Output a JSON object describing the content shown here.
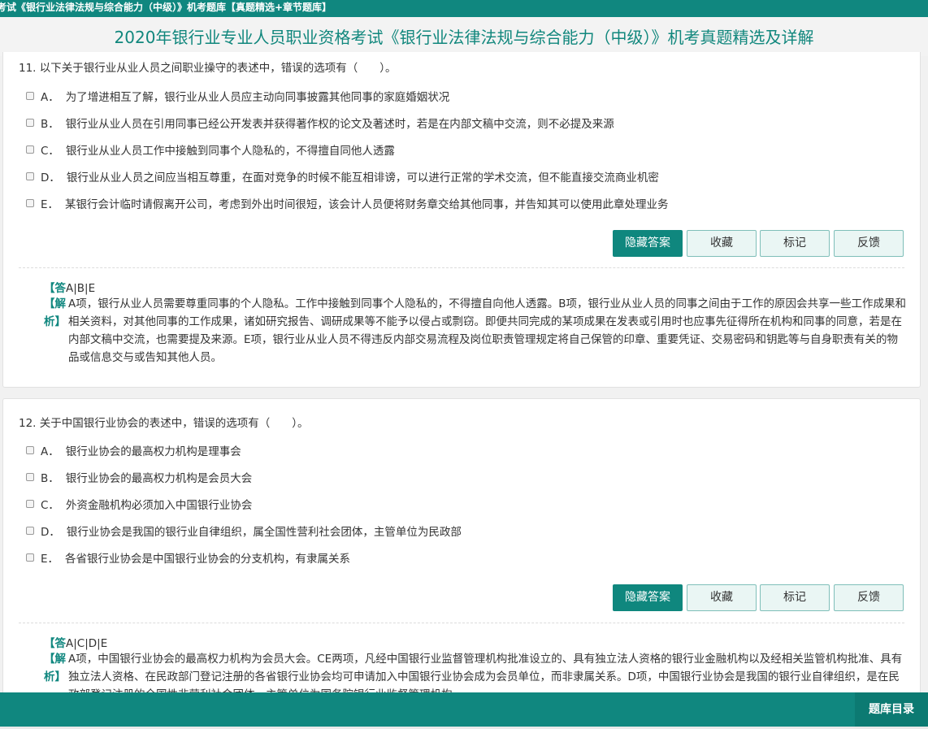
{
  "header": {
    "breadcrumb": "考试《银行业法律法规与综合能力（中级）》机考题库【真题精选+章节题库】",
    "title": "2020年银行业专业人员职业资格考试《银行业法律法规与综合能力（中级）》机考真题精选及详解"
  },
  "buttons": {
    "hide_answer": "隐藏答案",
    "favorite": "收藏",
    "mark": "标记",
    "feedback": "反馈"
  },
  "questions": [
    {
      "text": "11. 以下关于银行业从业人员之间职业操守的表述中，错误的选项有（　　）。",
      "options": [
        {
          "letter": "A．",
          "text": "为了增进相互了解，银行业从业人员应主动向同事披露其他同事的家庭婚姻状况"
        },
        {
          "letter": "B．",
          "text": "银行业从业人员在引用同事已经公开发表并获得著作权的论文及著述时，若是在内部文稿中交流，则不必提及来源"
        },
        {
          "letter": "C．",
          "text": "银行业从业人员工作中接触到同事个人隐私的，不得擅自同他人透露"
        },
        {
          "letter": "D．",
          "text": "银行业从业人员之间应当相互尊重，在面对竞争的时候不能互相诽谤，可以进行正常的学术交流，但不能直接交流商业机密"
        },
        {
          "letter": "E．",
          "text": "某银行会计临时请假离开公司，考虑到外出时间很短，该会计人员便将财务章交给其他同事，并告知其可以使用此章处理业务"
        }
      ],
      "answer_label": "【答",
      "answer": "A|B|E",
      "analysis_label": "【解析】",
      "analysis": "A项，银行从业人员需要尊重同事的个人隐私。工作中接触到同事个人隐私的，不得擅自向他人透露。B项，银行业从业人员的同事之间由于工作的原因会共享一些工作成果和相关资料，对其他同事的工作成果，诸如研究报告、调研成果等不能予以侵占或剽窃。即便共同完成的某项成果在发表或引用时也应事先征得所在机构和同事的同意，若是在内部文稿中交流，也需要提及来源。E项，银行业从业人员不得违反内部交易流程及岗位职责管理规定将自己保管的印章、重要凭证、交易密码和钥匙等与自身职责有关的物品或信息交与或告知其他人员。"
    },
    {
      "text": "12. 关于中国银行业协会的表述中，错误的选项有（　　）。",
      "options": [
        {
          "letter": "A．",
          "text": "银行业协会的最高权力机构是理事会"
        },
        {
          "letter": "B．",
          "text": "银行业协会的最高权力机构是会员大会"
        },
        {
          "letter": "C．",
          "text": "外资金融机构必须加入中国银行业协会"
        },
        {
          "letter": "D．",
          "text": "银行业协会是我国的银行业自律组织，属全国性营利社会团体，主管单位为民政部"
        },
        {
          "letter": "E．",
          "text": "各省银行业协会是中国银行业协会的分支机构，有隶属关系"
        }
      ],
      "answer_label": "【答",
      "answer": "A|C|D|E",
      "analysis_label": "【解析】",
      "analysis": "A项，中国银行业协会的最高权力机构为会员大会。CE两项，凡经中国银行业监督管理机构批准设立的、具有独立法人资格的银行业金融机构以及经相关监管机构批准、具有独立法人资格、在民政部门登记注册的各省银行业协会均可申请加入中国银行业协会成为会员单位，而非隶属关系。D项，中国银行业协会是我国的银行业自律组织，是在民政部登记注册的全国性非营利社会团体，主管单位为国务院银行业监督管理机构。"
    }
  ],
  "footer": {
    "catalog": "题库目录"
  }
}
